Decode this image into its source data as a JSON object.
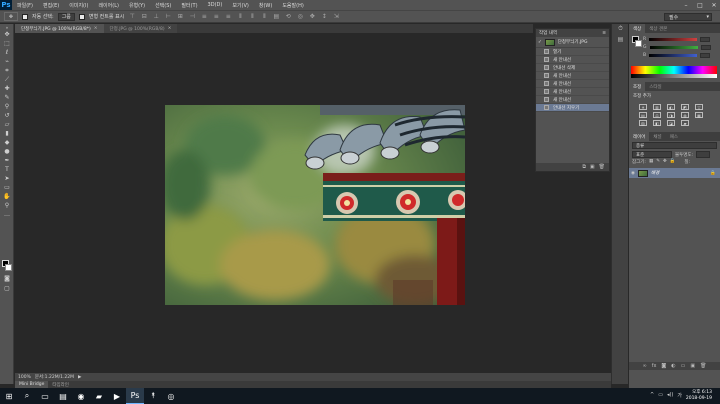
{
  "app": {
    "logo": "Ps"
  },
  "menu": [
    "파일(F)",
    "편집(E)",
    "이미지(I)",
    "레이어(L)",
    "유형(Y)",
    "선택(S)",
    "필터(T)",
    "3D(D)",
    "보기(V)",
    "창(W)",
    "도움말(H)"
  ],
  "options": {
    "auto_select_label": "자동 선택:",
    "auto_select_value": "그룹",
    "transform_label": "변형 컨트롤 표시",
    "workspace": "필수"
  },
  "tabs": [
    {
      "label": "단청무늬기.JPG @ 100%(RGB/8*)",
      "close": "×",
      "active": true
    },
    {
      "label": "단청.JPG @ 100%(RGB/8)",
      "close": "×",
      "active": false
    }
  ],
  "status": {
    "zoom": "100%",
    "doc": "문서:1.22M/1.22M",
    "arrow": "▶"
  },
  "bottom_tabs": [
    "Mini Bridge",
    "타임라인"
  ],
  "history": {
    "title": "작업 내역",
    "menu_icon": "≡",
    "snapshot": "단청무늬기.JPG",
    "items": [
      "열기",
      "새 안내선",
      "안내선 삭제",
      "새 안내선",
      "새 안내선",
      "새 안내선",
      "새 안내선",
      "안내선 지우기"
    ],
    "selected_index": 7,
    "foot_icons": [
      "⧉",
      "▣",
      "🗑"
    ]
  },
  "panels": {
    "color_tabs": [
      "색상",
      "색상 견본"
    ],
    "color_channels": [
      {
        "label": "R",
        "color": "#d04040"
      },
      {
        "label": "G",
        "color": "#40b040"
      },
      {
        "label": "B",
        "color": "#4060d0"
      }
    ],
    "adjust_tabs": [
      "조정",
      "스타일"
    ],
    "adjust_title": "조정 추가",
    "adjust_icons": [
      "☀",
      "▥",
      "◐",
      "◩",
      "▽",
      "▤",
      "⚖",
      "◑",
      "◍",
      "▦",
      "▨",
      "◧",
      "◪",
      "▰"
    ],
    "layer_tabs": [
      "레이어",
      "채널",
      "패스"
    ],
    "layer_kind": "종류",
    "layer_mode": "표준",
    "layer_opacity_label": "불투명도:",
    "layer_fill_label": "칠:",
    "layer_lock_label": "잠그기:",
    "layer_name": "배경"
  },
  "taskbar": {
    "icons": [
      "⊞",
      "⌕",
      "▭",
      "▤",
      "◉",
      "▰",
      "▶",
      "Ps",
      "⯭",
      "◎"
    ],
    "active_index": 7,
    "time": "오후 6:13",
    "date": "2018-09-19",
    "tray": [
      "^",
      "▭",
      "◂))",
      "가"
    ]
  },
  "colors": {
    "accent": "#6b7a94",
    "panel": "#535353",
    "canvas": "#282828"
  }
}
